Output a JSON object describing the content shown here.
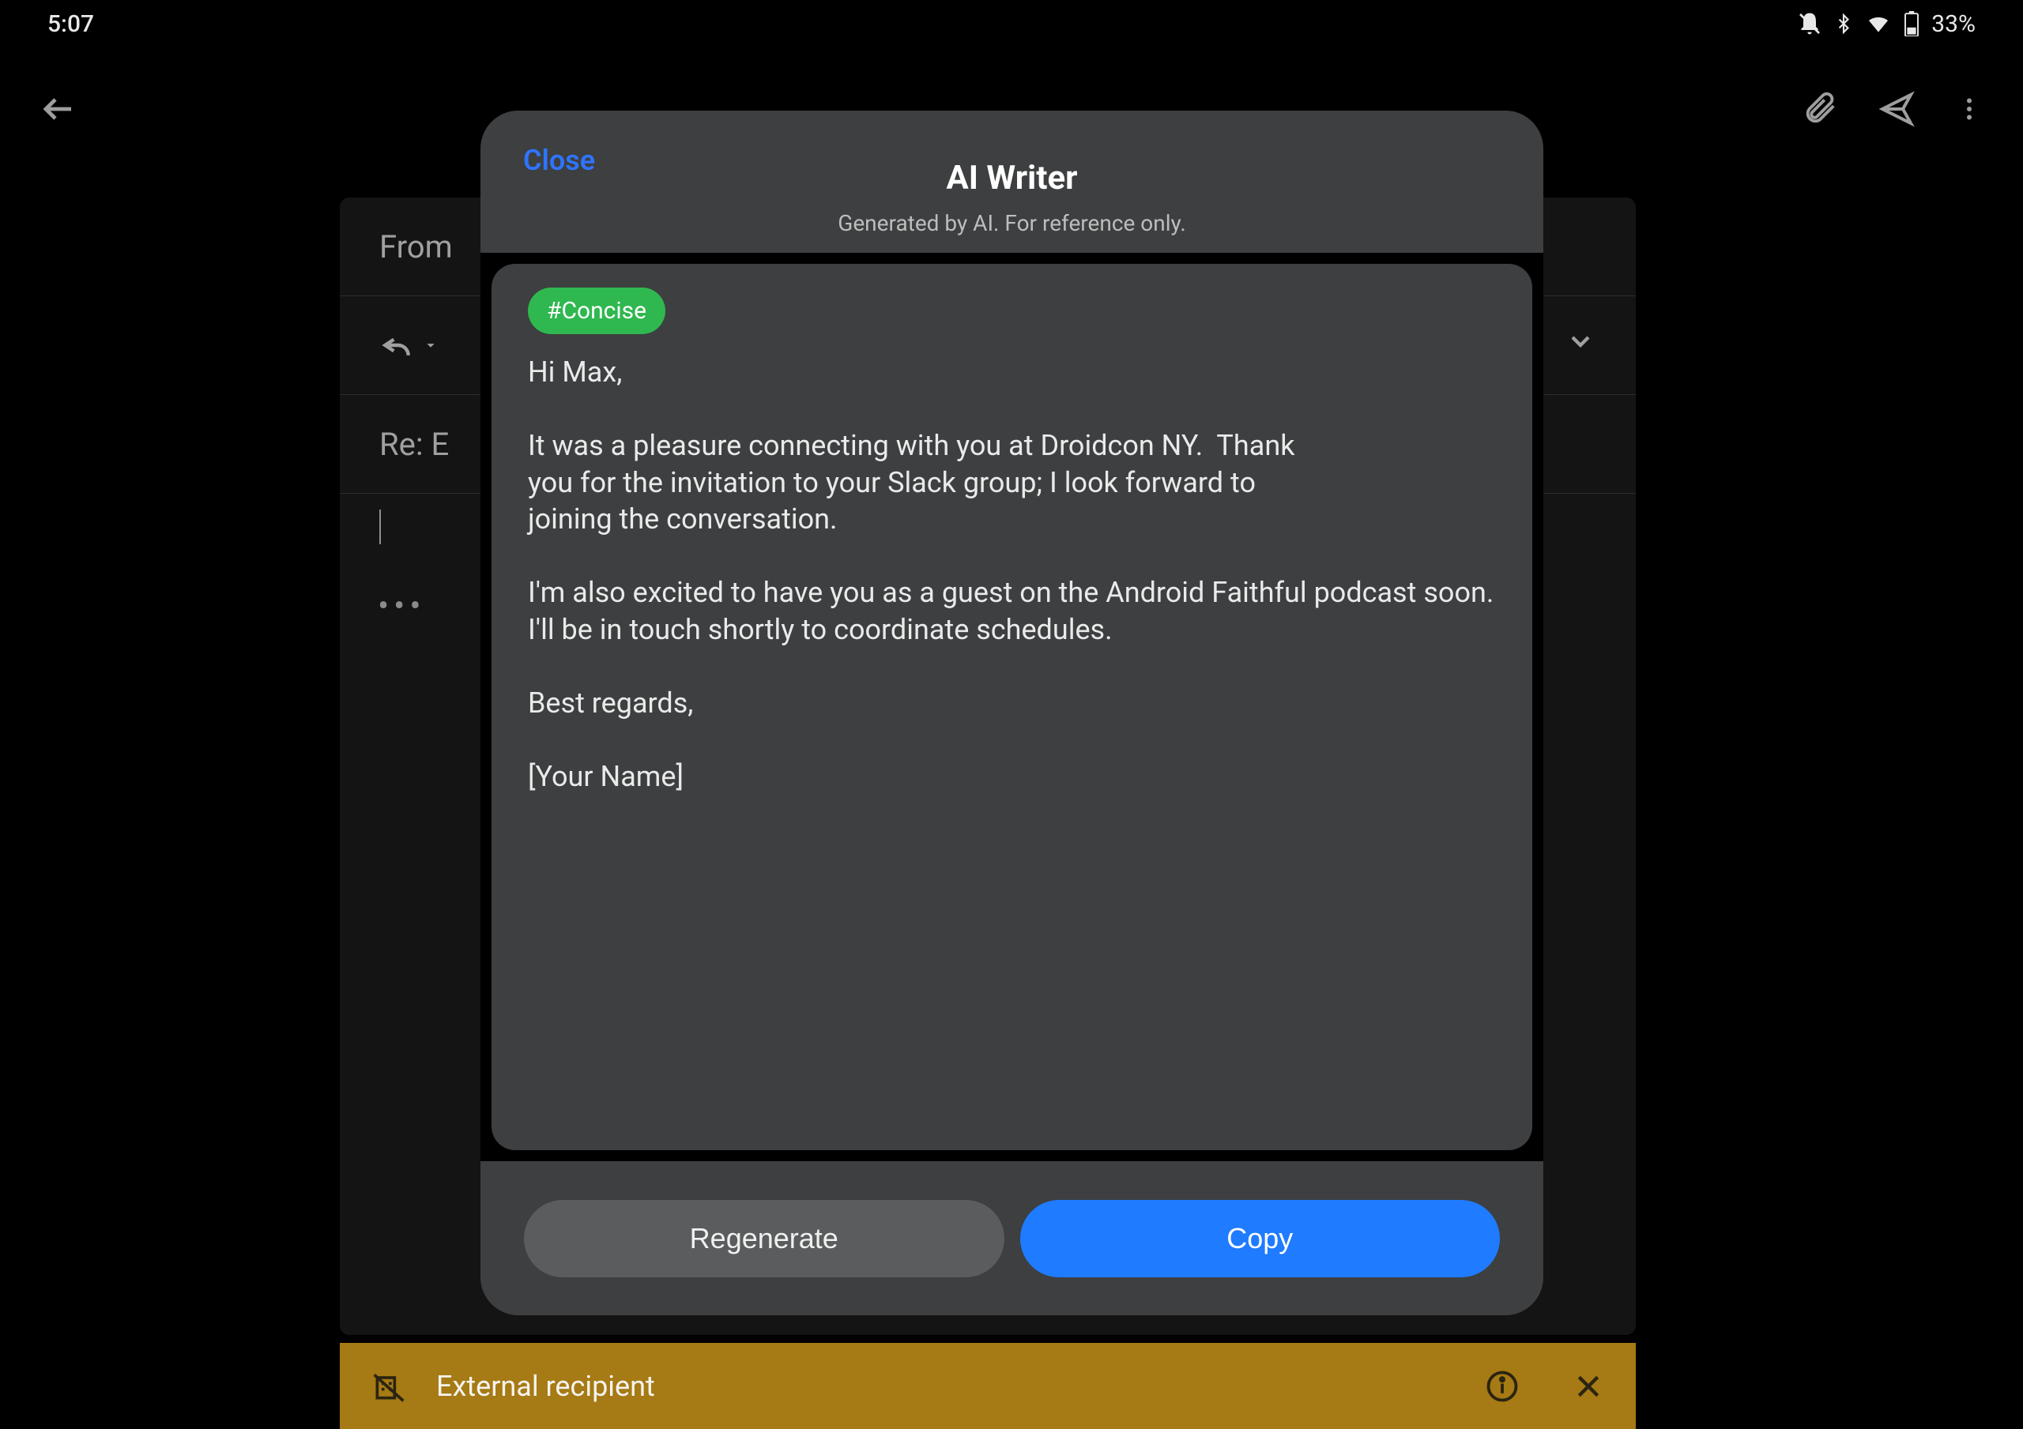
{
  "status": {
    "time": "5:07",
    "battery_pct": "33%"
  },
  "compose": {
    "from_label": "From",
    "subject": "Re: E"
  },
  "modal": {
    "close": "Close",
    "title": "AI Writer",
    "subtitle": "Generated by AI. For reference only.",
    "tag": "#Concise",
    "paragraphs": [
      "Hi Max,",
      "It was a pleasure connecting with you at Droidcon NY.  Thank you for the invitation to your Slack group; I look forward to joining the conversation.",
      "I'm also excited to have you as a guest on the Android Faithful podcast soon. I'll be in touch shortly to coordinate schedules.",
      "Best regards,",
      "[Your Name]"
    ],
    "regenerate": "Regenerate",
    "copy": "Copy"
  },
  "banner": {
    "text": "External recipient"
  }
}
